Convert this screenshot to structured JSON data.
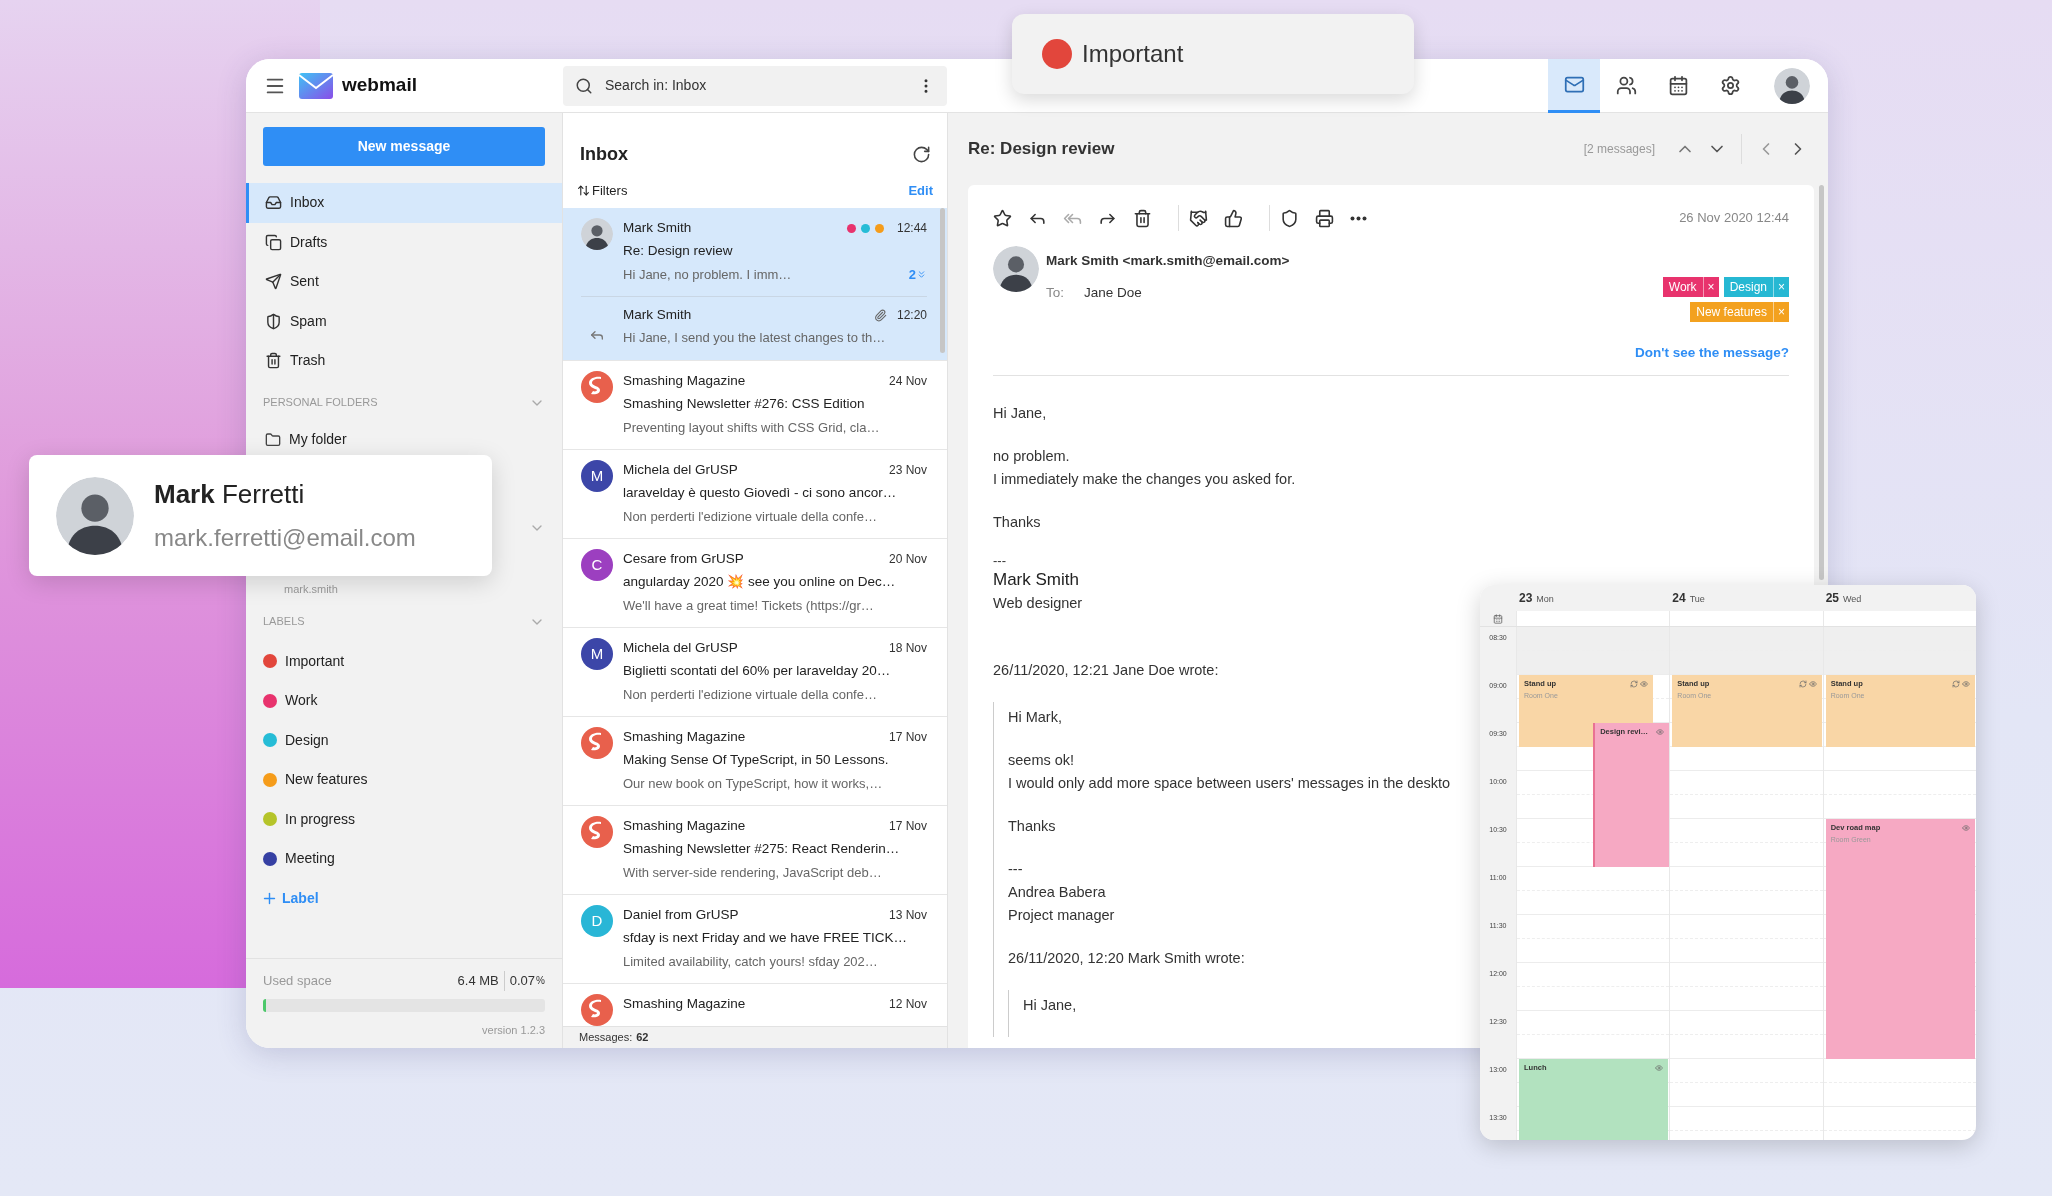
{
  "important_popup": {
    "label": "Important",
    "color": "#e2463c"
  },
  "app": {
    "name": "webmail"
  },
  "search": {
    "placeholder": "Search in: Inbox"
  },
  "nav": [
    {
      "kind": "mail",
      "selected": true
    },
    {
      "kind": "contacts",
      "selected": false
    },
    {
      "kind": "calendar",
      "selected": false
    },
    {
      "kind": "settings",
      "selected": false
    }
  ],
  "sidebar": {
    "new_message": "New message",
    "folders": [
      {
        "kind": "inbox",
        "label": "Inbox",
        "selected": true
      },
      {
        "kind": "drafts",
        "label": "Drafts",
        "selected": false
      },
      {
        "kind": "sent",
        "label": "Sent",
        "selected": false
      },
      {
        "kind": "spam",
        "label": "Spam",
        "selected": false
      },
      {
        "kind": "trash",
        "label": "Trash",
        "selected": false
      }
    ],
    "personal_folders": {
      "title": "PERSONAL FOLDERS",
      "items": [
        {
          "label": "My folder",
          "selected": false
        }
      ]
    },
    "account": {
      "username": "mark.smith"
    },
    "labels": {
      "title": "LABELS",
      "items": [
        {
          "name": "Important",
          "color": "#e2463c"
        },
        {
          "name": "Work",
          "color": "#e8336d"
        },
        {
          "name": "Design",
          "color": "#26bcd6"
        },
        {
          "name": "New features",
          "color": "#f59c1a"
        },
        {
          "name": "In progress",
          "color": "#b5c42a"
        },
        {
          "name": "Meeting",
          "color": "#3640a3"
        }
      ],
      "add": "Label"
    },
    "storage": {
      "label": "Used space",
      "size": "6.4 MB",
      "percent": "0.07",
      "unit": "%",
      "level": 0.01
    },
    "version": "version 1.2.3"
  },
  "profile_card": {
    "name": "**Mark** Ferretti",
    "email": "mark.ferretti@email.com"
  },
  "message_list": {
    "title": "Inbox",
    "filters": "Filters",
    "edit": "Edit",
    "footer_label": "Messages:",
    "footer_count": "62",
    "threads": [
      {
        "selected": true,
        "avatar": {
          "kind": "photo"
        },
        "sender": "Mark Smith",
        "labels": [
          {
            "color": "#e8336d"
          },
          {
            "color": "#26bcd6"
          },
          {
            "color": "#f59c1a"
          }
        ],
        "time": "12:44",
        "subject": "Re: Design review",
        "preview": "Hi Jane, no problem. I imm…",
        "count": "2",
        "replies": [
          {
            "sender": "Mark Smith",
            "attachment": true,
            "time": "12:20",
            "preview": "Hi Jane, I send you the latest changes to th…"
          }
        ]
      },
      {
        "selected": false,
        "avatar": {
          "kind": "logo",
          "color": "#e8604c"
        },
        "sender": "Smashing Magazine",
        "time": "24 Nov",
        "subject": "Smashing Newsletter #276: CSS Edition",
        "preview": "Preventing layout shifts with CSS Grid, cla…"
      },
      {
        "selected": false,
        "avatar": {
          "kind": "letter",
          "letter": "M",
          "color": "#3c46a8"
        },
        "sender": "Michela del GrUSP",
        "time": "23 Nov",
        "subject": "laravelday è questo Giovedì - ci sono ancor…",
        "preview": "Non perderti l'edizione virtuale della confe…"
      },
      {
        "selected": false,
        "avatar": {
          "kind": "letter",
          "letter": "C",
          "color": "#9c3fc0"
        },
        "sender": "Cesare from GrUSP",
        "time": "20 Nov",
        "subject": "angularday 2020 💥  see you online on Dec…",
        "preview": "We'll have a great time!  Tickets (https://gr…"
      },
      {
        "selected": false,
        "avatar": {
          "kind": "letter",
          "letter": "M",
          "color": "#3c46a8"
        },
        "sender": "Michela del GrUSP",
        "time": "18 Nov",
        "subject": "Biglietti scontati del 60% per laravelday 20…",
        "preview": "Non perderti l'edizione virtuale della confe…"
      },
      {
        "selected": false,
        "avatar": {
          "kind": "logo",
          "color": "#e8604c"
        },
        "sender": "Smashing Magazine",
        "time": "17 Nov",
        "subject": "Making Sense Of TypeScript, in 50 Lessons.",
        "preview": "Our new book on TypeScript, how it works,…"
      },
      {
        "selected": false,
        "avatar": {
          "kind": "logo",
          "color": "#e8604c"
        },
        "sender": "Smashing Magazine",
        "time": "17 Nov",
        "subject": "Smashing Newsletter #275: React Renderin…",
        "preview": "With server-side rendering, JavaScript deb…"
      },
      {
        "selected": false,
        "avatar": {
          "kind": "letter",
          "letter": "D",
          "color": "#29b6d6"
        },
        "sender": "Daniel from GrUSP",
        "time": "13 Nov",
        "subject": "sfday is next Friday and we have FREE TICK…",
        "preview": "Limited availability, catch yours!  sfday 202…"
      },
      {
        "selected": false,
        "avatar": {
          "kind": "logo",
          "color": "#e8604c"
        },
        "sender": "Smashing Magazine",
        "time": "12 Nov"
      }
    ]
  },
  "reader": {
    "title": "Re: Design review",
    "count": "[2 messages]",
    "toolbar": [
      {
        "kind": "star",
        "disabled": false
      },
      {
        "kind": "reply",
        "disabled": false
      },
      {
        "kind": "reply_all",
        "disabled": true
      },
      {
        "kind": "forward",
        "disabled": false
      },
      {
        "kind": "delete",
        "disabled": false
      },
      {
        "kind": "separator"
      },
      {
        "kind": "handshake",
        "disabled": false
      },
      {
        "kind": "like",
        "disabled": false
      },
      {
        "kind": "separator"
      },
      {
        "kind": "shield",
        "disabled": false
      },
      {
        "kind": "print",
        "disabled": false
      },
      {
        "kind": "more",
        "disabled": false
      }
    ],
    "date": "26 Nov 2020 12:44",
    "from": "Mark Smith <mark.smith@email.com>",
    "to_label": "To:",
    "to": "Jane Doe",
    "tags": [
      {
        "name": "Work",
        "color": "#e8336d"
      },
      {
        "name": "Design",
        "color": "#26b8d3"
      },
      {
        "name": "New features",
        "color": "#f3a11f"
      }
    ],
    "tags_remove": "×",
    "help_link": "Don't see the message?",
    "body": [
      {
        "kind": "text",
        "text": "Hi Jane,"
      },
      {
        "kind": "text",
        "text": "no problem.\nI immediately make the changes you asked for."
      },
      {
        "kind": "text",
        "text": "Thanks"
      },
      {
        "kind": "signature",
        "dashes": "---",
        "name": "Mark Smith",
        "role": "Web designer"
      },
      {
        "kind": "text",
        "text": "26/11/2020, 12:21 Jane Doe wrote:"
      },
      {
        "kind": "quote",
        "blocks": [
          {
            "kind": "text",
            "text": "Hi Mark,"
          },
          {
            "kind": "text",
            "text": "seems ok!\nI would only add more space between users' messages in the deskto"
          },
          {
            "kind": "text",
            "text": "Thanks"
          },
          {
            "kind": "text",
            "text": "---\nAndrea Babera\nProject manager"
          },
          {
            "kind": "text",
            "text": "26/11/2020, 12:20 Mark Smith  wrote:"
          },
          {
            "kind": "quote",
            "blocks": [
              {
                "kind": "text",
                "text": "Hi Jane,"
              }
            ]
          }
        ]
      }
    ]
  },
  "calendar": {
    "times": [
      "08:30",
      "09:00",
      "09:30",
      "10:00",
      "10:30",
      "11:00",
      "11:30",
      "12:00",
      "12:30",
      "13:00",
      "13:30"
    ],
    "days": [
      {
        "day": "23",
        "weekday": "Mon",
        "events": [
          {
            "title": "Stand up",
            "location": "Room One",
            "color": "#f9d6a6",
            "recurring": true
          },
          {
            "title": "Design revi…",
            "color": "#f6a9c3",
            "recurring": false
          },
          {
            "title": "Lunch",
            "color": "#b2e2bf",
            "recurring": false
          }
        ]
      },
      {
        "day": "24",
        "weekday": "Tue",
        "events": [
          {
            "title": "Stand up",
            "location": "Room One",
            "color": "#f9d6a6",
            "recurring": true
          }
        ]
      },
      {
        "day": "25",
        "weekday": "Wed",
        "events": [
          {
            "title": "Stand up",
            "location": "Room One",
            "color": "#f9d6a6",
            "recurring": true
          },
          {
            "title": "Dev road map",
            "location": "Room Green",
            "color": "#f6a9c3",
            "recurring": false
          }
        ]
      }
    ]
  }
}
